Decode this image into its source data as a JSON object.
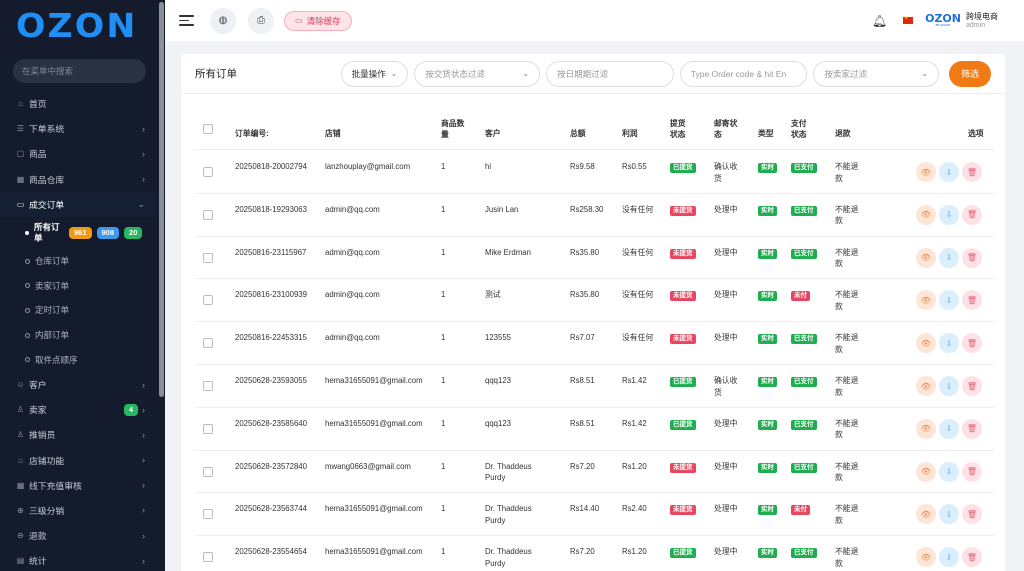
{
  "sidebar": {
    "logo": "OZON",
    "search_placeholder": "在菜单中搜索",
    "items": [
      {
        "icon": "home-icon",
        "glyph": "⌂",
        "label": "首页",
        "arrow": ""
      },
      {
        "icon": "list-icon",
        "glyph": "☰",
        "label": "下单系统",
        "arrow": "›"
      },
      {
        "icon": "bag-icon",
        "glyph": "▢",
        "label": "商品",
        "arrow": "›"
      },
      {
        "icon": "warehouse-icon",
        "glyph": "▦",
        "label": "商品仓库",
        "arrow": "›"
      }
    ],
    "deal_order": {
      "icon": "card-icon",
      "glyph": "▭",
      "label": "成交订单",
      "arrow": "⌄"
    },
    "subitems": [
      {
        "label": "所有订单",
        "active": true,
        "badges": [
          {
            "text": "961",
            "color": "#f29a12"
          },
          {
            "text": "908",
            "color": "#3c9af0"
          },
          {
            "text": "20",
            "color": "#27b861"
          }
        ]
      },
      {
        "label": "仓库订单"
      },
      {
        "label": "卖家订单"
      },
      {
        "label": "定时订单"
      },
      {
        "label": "内部订单"
      },
      {
        "label": "取件点顺序"
      }
    ],
    "items2": [
      {
        "icon": "customers-icon",
        "glyph": "☺",
        "label": "客户",
        "arrow": "›"
      },
      {
        "icon": "seller-icon",
        "glyph": "♙",
        "label": "卖家",
        "arrow": "›",
        "badge": "4"
      },
      {
        "icon": "promoter-icon",
        "glyph": "♙",
        "label": "推销员",
        "arrow": "›"
      },
      {
        "icon": "store-icon",
        "glyph": "⌂",
        "label": "店铺功能",
        "arrow": "›"
      },
      {
        "icon": "recharge-icon",
        "glyph": "▦",
        "label": "线下充值审核",
        "arrow": "›"
      },
      {
        "icon": "distribution-icon",
        "glyph": "⊕",
        "label": "三级分销",
        "arrow": "›"
      },
      {
        "icon": "refund-icon",
        "glyph": "⊖",
        "label": "退款",
        "arrow": "›"
      },
      {
        "icon": "stats-icon",
        "glyph": "▤",
        "label": "统计",
        "arrow": "›"
      }
    ]
  },
  "topbar": {
    "clear_cache": "清除缓存",
    "mini_logo": "OZON",
    "mini_logo_sub": "BE SMART",
    "user_title": "跨境电商",
    "user_role": "admin"
  },
  "filters": {
    "title": "所有订单",
    "bulk": "批量操作",
    "status_placeholder": "按交货状态过滤",
    "date_placeholder": "按日期期过滤",
    "code_placeholder": "Type Order code & hit En",
    "seller_placeholder": "按卖家过滤",
    "filter_button": "筛选"
  },
  "table": {
    "headers": {
      "order_no": "订单编号:",
      "store": "店铺",
      "qty": "商品数量",
      "customer": "客户",
      "total": "总额",
      "profit": "利润",
      "pickup": "提货状态",
      "mail": "邮寄状态",
      "type": "类型",
      "payment": "支付状态",
      "refund": "退款",
      "options": "选项"
    },
    "rows": [
      {
        "order_no": "20250818-20002794",
        "store": "lanzhouplay@gmail.com",
        "qty": "1",
        "customer": "hi",
        "total": "Rs9.58",
        "profit": "Rs0.55",
        "pickup": "已提货",
        "pickup_ok": true,
        "mail": "确认收货",
        "type": "实时",
        "payment": "已支付",
        "pay_ok": true,
        "refund": "不能退款"
      },
      {
        "order_no": "20250818-19293063",
        "store": "admin@qq.com",
        "qty": "1",
        "customer": "Jusin Lan",
        "total": "Rs258.30",
        "profit": "没有任何",
        "pickup": "未提货",
        "pickup_ok": false,
        "mail": "处理中",
        "type": "实时",
        "payment": "已支付",
        "pay_ok": true,
        "refund": "不能退款"
      },
      {
        "order_no": "20250816-23115967",
        "store": "admin@qq.com",
        "qty": "1",
        "customer": "Mike Erdman",
        "total": "Rs35.80",
        "profit": "没有任何",
        "pickup": "未提货",
        "pickup_ok": false,
        "mail": "处理中",
        "type": "实时",
        "payment": "已支付",
        "pay_ok": true,
        "refund": "不能退款"
      },
      {
        "order_no": "20250816-23100939",
        "store": "admin@qq.com",
        "qty": "1",
        "customer": "测试",
        "total": "Rs35.80",
        "profit": "没有任何",
        "pickup": "未提货",
        "pickup_ok": false,
        "mail": "处理中",
        "type": "实时",
        "payment": "未付",
        "pay_ok": false,
        "refund": "不能退款"
      },
      {
        "order_no": "20250816-22453315",
        "store": "admin@qq.com",
        "qty": "1",
        "customer": "123555",
        "total": "Rs7.07",
        "profit": "没有任何",
        "pickup": "未提货",
        "pickup_ok": false,
        "mail": "处理中",
        "type": "实时",
        "payment": "已支付",
        "pay_ok": true,
        "refund": "不能退款"
      },
      {
        "order_no": "20250628-23593055",
        "store": "hema31655091@gmail.com",
        "qty": "1",
        "customer": "qqq123",
        "total": "Rs8.51",
        "profit": "Rs1.42",
        "pickup": "已提货",
        "pickup_ok": true,
        "mail": "确认收货",
        "type": "实时",
        "payment": "已支付",
        "pay_ok": true,
        "refund": "不能退款"
      },
      {
        "order_no": "20250628-23585640",
        "store": "hema31655091@gmail.com",
        "qty": "1",
        "customer": "qqq123",
        "total": "Rs8.51",
        "profit": "Rs1.42",
        "pickup": "已提货",
        "pickup_ok": true,
        "mail": "处理中",
        "type": "实时",
        "payment": "已支付",
        "pay_ok": true,
        "refund": "不能退款"
      },
      {
        "order_no": "20250628-23572840",
        "store": "mwang0663@gmail.com",
        "qty": "1",
        "customer": "Dr. Thaddeus Purdy",
        "total": "Rs7.20",
        "profit": "Rs1.20",
        "pickup": "未提货",
        "pickup_ok": false,
        "mail": "处理中",
        "type": "实时",
        "payment": "已支付",
        "pay_ok": true,
        "refund": "不能退款"
      },
      {
        "order_no": "20250628-23563744",
        "store": "hema31655091@gmail.com",
        "qty": "1",
        "customer": "Dr. Thaddeus Purdy",
        "total": "Rs14.40",
        "profit": "Rs2.40",
        "pickup": "未提货",
        "pickup_ok": false,
        "mail": "处理中",
        "type": "实时",
        "payment": "未付",
        "pay_ok": false,
        "refund": "不能退款"
      },
      {
        "order_no": "20250628-23554654",
        "store": "hema31655091@gmail.com",
        "qty": "1",
        "customer": "Dr. Thaddeus Purdy",
        "total": "Rs7.20",
        "profit": "Rs1.20",
        "pickup": "已提货",
        "pickup_ok": true,
        "mail": "处理中",
        "type": "实时",
        "payment": "已支付",
        "pay_ok": true,
        "refund": "不能退款"
      }
    ]
  },
  "colors": {
    "accent": "#f07b16",
    "brand": "#1f8ff5",
    "sidebar_bg": "#131b2d",
    "tag_green": "#20ad4f",
    "tag_red": "#e8465e"
  }
}
